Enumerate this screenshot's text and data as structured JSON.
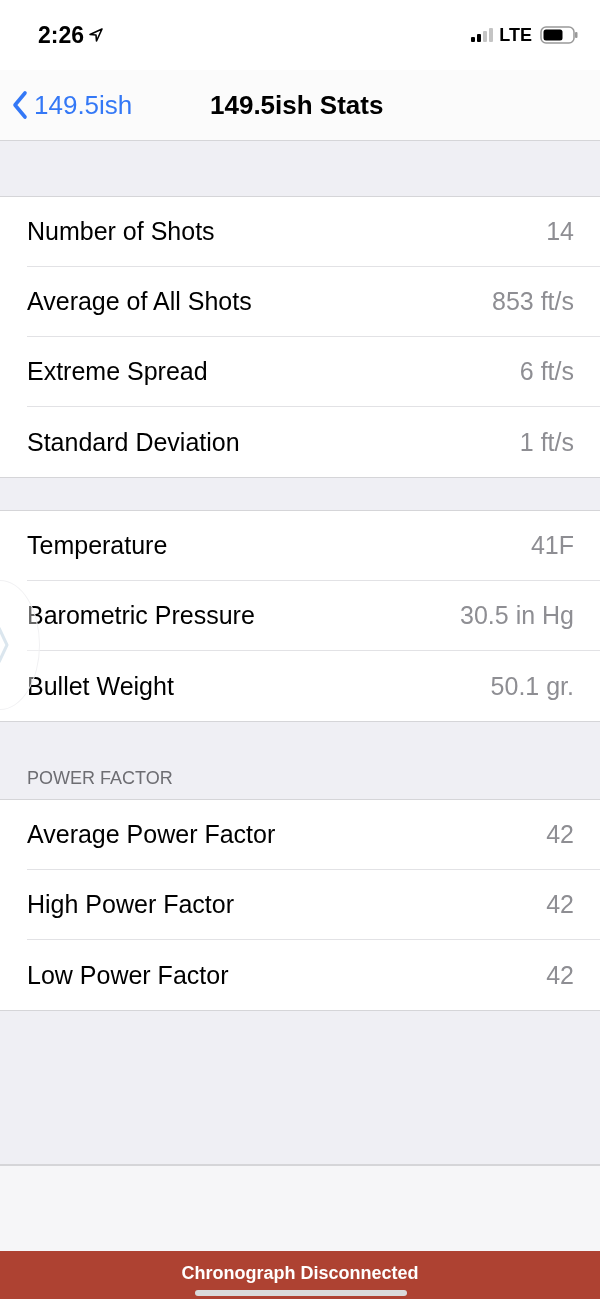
{
  "status_bar": {
    "time": "2:26",
    "network": "LTE"
  },
  "nav": {
    "back": "149.5ish",
    "title": "149.5ish Stats"
  },
  "sections": [
    {
      "rows": [
        {
          "label": "Number of Shots",
          "value": "14"
        },
        {
          "label": "Average of All Shots",
          "value": "853 ft/s"
        },
        {
          "label": "Extreme Spread",
          "value": "6 ft/s"
        },
        {
          "label": "Standard Deviation",
          "value": "1 ft/s"
        }
      ]
    },
    {
      "rows": [
        {
          "label": "Temperature",
          "value": "41F"
        },
        {
          "label": "Barometric Pressure",
          "value": "30.5 in Hg"
        },
        {
          "label": "Bullet Weight",
          "value": "50.1 gr."
        }
      ]
    },
    {
      "header": "POWER FACTOR",
      "rows": [
        {
          "label": "Average Power Factor",
          "value": "42"
        },
        {
          "label": "High Power Factor",
          "value": "42"
        },
        {
          "label": "Low Power Factor",
          "value": "42"
        }
      ]
    }
  ],
  "banner": "Chronograph Disconnected"
}
